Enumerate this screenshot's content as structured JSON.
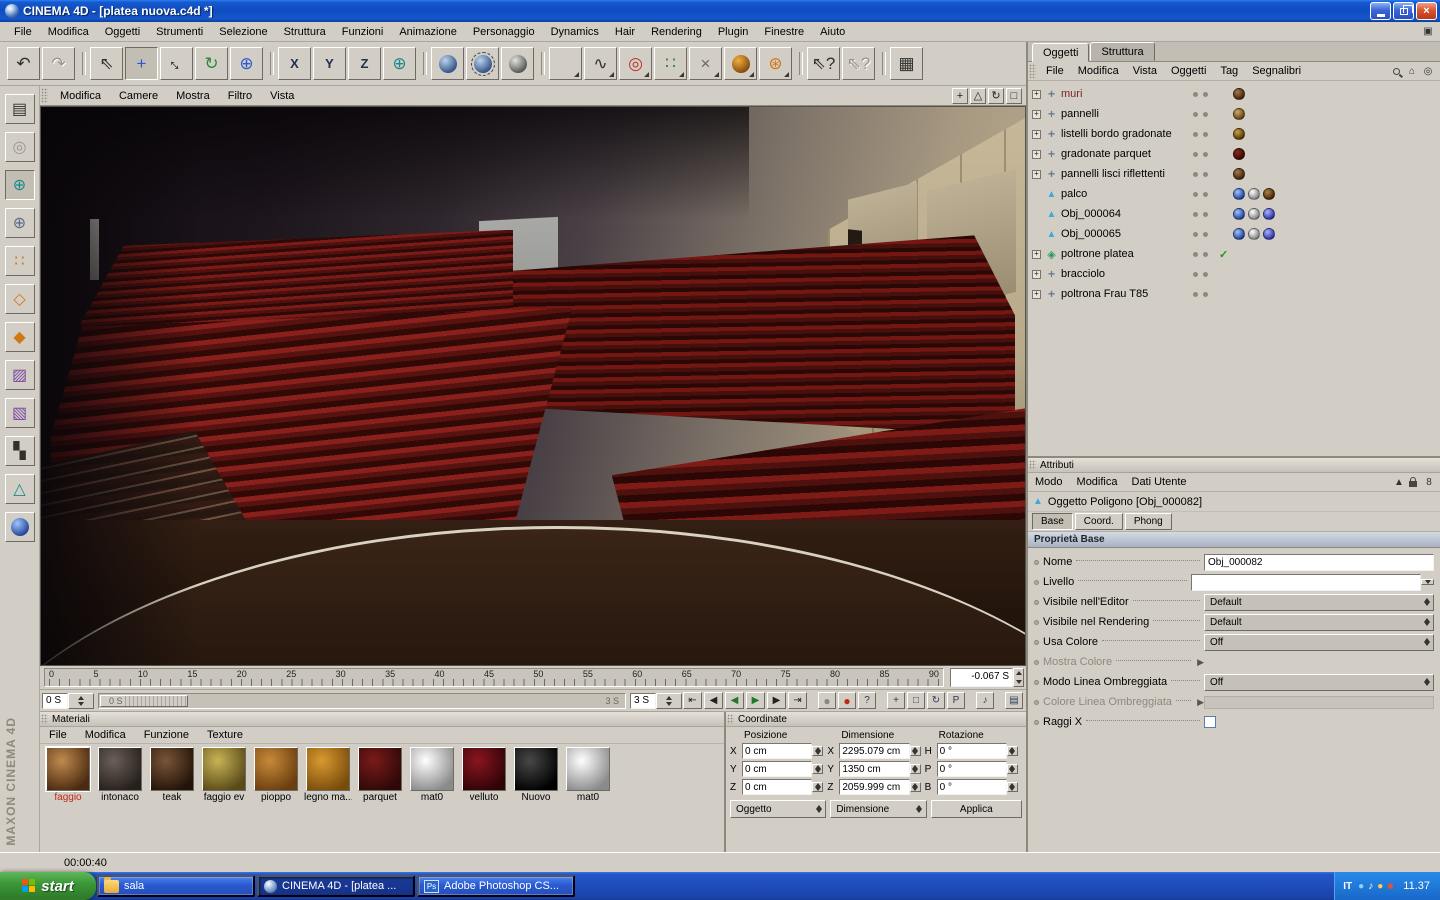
{
  "window": {
    "title": "CINEMA 4D - [platea nuova.c4d *]"
  },
  "menubar": {
    "items": [
      "File",
      "Modifica",
      "Oggetti",
      "Strumenti",
      "Selezione",
      "Struttura",
      "Funzioni",
      "Animazione",
      "Personaggio",
      "Dynamics",
      "Hair",
      "Rendering",
      "Plugin",
      "Finestre",
      "Aiuto"
    ]
  },
  "toolbar": {
    "buttons": [
      {
        "id": "undo-button",
        "glyph": "↶",
        "cls": "c-dark"
      },
      {
        "id": "redo-button",
        "glyph": "↷",
        "cls": "disabled"
      },
      {
        "id": "selection-tool",
        "glyph": "⇖",
        "cls": "c-dark",
        "gap": "gap"
      },
      {
        "id": "move-tool",
        "glyph": "+",
        "cls": "c-blue active"
      },
      {
        "id": "scale-tool",
        "glyph": "↔",
        "cls": "c-dark rot45"
      },
      {
        "id": "rotate-tool",
        "glyph": "↻",
        "cls": "c-green"
      },
      {
        "id": "current-tool",
        "glyph": "⊕",
        "cls": "c-blue"
      },
      {
        "id": "lock-x-button",
        "glyph": "X",
        "cls": "axis",
        "gap": "gap"
      },
      {
        "id": "lock-y-button",
        "glyph": "Y",
        "cls": "axis"
      },
      {
        "id": "lock-z-button",
        "glyph": "Z",
        "cls": "axis"
      },
      {
        "id": "coordinate-system-button",
        "glyph": "⊕",
        "cls": "c-teal"
      },
      {
        "id": "render-view-button",
        "ball": "#bcd3ee/#27497c",
        "gap": "gap"
      },
      {
        "id": "render-active-button",
        "ball": "#bcd3ee/#27497c",
        "cls": "framed"
      },
      {
        "id": "render-settings-button",
        "ball": "#e2e2e0/#4a4a46"
      },
      {
        "id": "add-primitive-button",
        "cube": "cube",
        "cls": "pal",
        "gap": "gap"
      },
      {
        "id": "add-spline-button",
        "glyph": "∿",
        "cls": "c-dark pal"
      },
      {
        "id": "add-nurbs-button",
        "glyph": "◎",
        "cls": "c-red pal"
      },
      {
        "id": "add-array-button",
        "glyph": "∷",
        "cls": "c-green pal"
      },
      {
        "id": "add-boole-button",
        "glyph": "×",
        "cls": "c-gray pal"
      },
      {
        "id": "add-sky-button",
        "ball": "#f0b040/#7a4208",
        "cls": "pal"
      },
      {
        "id": "add-character-button",
        "glyph": "⊛",
        "cls": "c-orange pal"
      },
      {
        "id": "help-pointer-button",
        "glyph": "⇖?",
        "cls": "c-dark",
        "gap": "gap"
      },
      {
        "id": "selection-filter-button",
        "glyph": "⇖?",
        "cls": "disabled"
      },
      {
        "id": "layout-button",
        "glyph": "▦",
        "cls": "c-dark",
        "gap": "gap"
      }
    ]
  },
  "left_toolbar": {
    "buttons": [
      {
        "id": "make-editable-button",
        "glyph": "▤",
        "cls": "c-dark"
      },
      {
        "id": "model-mode-button",
        "glyph": "◎",
        "cls": "disabled"
      },
      {
        "id": "axis-mode-button",
        "glyph": "⊕",
        "cls": "c-teal active"
      },
      {
        "id": "object-mode-button",
        "glyph": "⊕",
        "cls": "c-slate"
      },
      {
        "id": "point-mode-button",
        "glyph": "∷",
        "cls": "c-orange"
      },
      {
        "id": "edge-mode-button",
        "glyph": "◇",
        "cls": "c-orange"
      },
      {
        "id": "polygon-mode-button",
        "glyph": "◆",
        "cls": "c-orange"
      },
      {
        "id": "texture-mode-button",
        "glyph": "▨",
        "cls": "c-purple"
      },
      {
        "id": "texture-axis-mode-button",
        "glyph": "▧",
        "cls": "c-purple"
      },
      {
        "id": "uv-mode-button",
        "glyph": "▚",
        "cls": "c-dark"
      },
      {
        "id": "workplane-button",
        "glyph": "△",
        "cls": "c-teal"
      },
      {
        "id": "coordinates-button",
        "ball": "#9fc4ff/#1a3a8c"
      }
    ]
  },
  "viewport": {
    "menu": [
      "Modifica",
      "Camere",
      "Mostra",
      "Filtro",
      "Vista"
    ],
    "icons": [
      {
        "id": "viewport-pan-icon",
        "glyph": "+"
      },
      {
        "id": "viewport-zoom-icon",
        "glyph": "△"
      },
      {
        "id": "viewport-rotate-icon",
        "glyph": "↻"
      },
      {
        "id": "viewport-maximize-icon",
        "glyph": "□"
      }
    ]
  },
  "timeline": {
    "ticks": [
      "0",
      "5",
      "10",
      "15",
      "20",
      "25",
      "30",
      "35",
      "40",
      "45",
      "50",
      "55",
      "60",
      "65",
      "70",
      "75",
      "80",
      "85",
      "90"
    ],
    "frame_value": "-0.067 S"
  },
  "anim": {
    "start_value": "0 S",
    "handle_label": "0 S",
    "range_end_label": "3 S",
    "end_value": "3 S",
    "transport": [
      {
        "id": "goto-start-button",
        "glyph": "⇤"
      },
      {
        "id": "prev-key-button",
        "glyph": "◀"
      },
      {
        "id": "play-reverse-button",
        "glyph": "◀",
        "cls": "green"
      },
      {
        "id": "play-button",
        "glyph": "▶",
        "cls": "green"
      },
      {
        "id": "next-key-button",
        "glyph": "▶"
      },
      {
        "id": "goto-end-button",
        "glyph": "⇥"
      }
    ],
    "record": [
      {
        "id": "record-keyframe-button",
        "glyph": "●",
        "cls": "gray-ball gap"
      },
      {
        "id": "record-button",
        "glyph": "●",
        "cls": "red-ball"
      },
      {
        "id": "help-button",
        "glyph": "?"
      },
      {
        "id": "key-position-button",
        "glyph": "+",
        "cls": "gap"
      },
      {
        "id": "key-scale-button",
        "glyph": "□"
      },
      {
        "id": "key-rotation-button",
        "glyph": "↻"
      },
      {
        "id": "key-parameter-button",
        "glyph": "P"
      },
      {
        "id": "sound-button",
        "glyph": "♪",
        "cls": "gap"
      },
      {
        "id": "mini-panel-button",
        "glyph": "▤",
        "cls": "gap"
      }
    ]
  },
  "materials": {
    "title": "Materiali",
    "menu": [
      "File",
      "Modifica",
      "Funzione",
      "Texture"
    ],
    "items": [
      {
        "name": "faggio",
        "hi": "#c08a4f",
        "lo": "#4a2a10",
        "cls": "selected"
      },
      {
        "name": "intonaco",
        "hi": "#6b5f58",
        "lo": "#26201c"
      },
      {
        "name": "teak",
        "hi": "#7a5538",
        "lo": "#221408"
      },
      {
        "name": "faggio ev",
        "hi": "#c8b456",
        "lo": "#5a4a18"
      },
      {
        "name": "pioppo",
        "hi": "#c88a3a",
        "lo": "#6a3e0e"
      },
      {
        "name": "legno ma...",
        "hi": "#d89a30",
        "lo": "#7a4c0c"
      },
      {
        "name": "parquet",
        "hi": "#7a1a1a",
        "lo": "#2e0808"
      },
      {
        "name": "mat0",
        "hi": "#ffffff",
        "lo": "#8a8a8a"
      },
      {
        "name": "velluto",
        "hi": "#8a1520",
        "lo": "#2e0406"
      },
      {
        "name": "Nuovo",
        "hi": "#484848",
        "lo": "#000000"
      },
      {
        "name": "mat0",
        "hi": "#ffffff",
        "lo": "#8a8a8a"
      }
    ]
  },
  "coordinates": {
    "title": "Coordinate",
    "col_position": "Posizione",
    "col_dimension": "Dimensione",
    "col_rotation": "Rotazione",
    "pos": {
      "xl": "X",
      "x": "0 cm",
      "yl": "Y",
      "y": "0 cm",
      "zl": "Z",
      "z": "0 cm"
    },
    "dim": {
      "xl": "X",
      "x": "2295.079 cm",
      "yl": "Y",
      "y": "1350 cm",
      "zl": "Z",
      "z": "2059.999 cm"
    },
    "rot": {
      "hl": "H",
      "h": "0 °",
      "pl": "P",
      "p": "0 °",
      "bl": "B",
      "b": "0 °"
    },
    "mode_object": "Oggetto",
    "mode_dimension": "Dimensione",
    "apply": "Applica"
  },
  "object_manager": {
    "tabs": {
      "objects": "Oggetti",
      "structure": "Struttura"
    },
    "menu": [
      "File",
      "Modifica",
      "Vista",
      "Oggetti",
      "Tag",
      "Segnalibri"
    ],
    "items": [
      {
        "label": "muri",
        "type": "group",
        "expand": "+",
        "color": "#7a1f1f",
        "tags": [
          {
            "hi": "#a87848",
            "lo": "#3a2008"
          }
        ]
      },
      {
        "label": "pannelli",
        "type": "group",
        "expand": "+",
        "tags": [
          {
            "hi": "#cfa964",
            "lo": "#5a3c14"
          }
        ]
      },
      {
        "label": "listelli bordo gradonate",
        "type": "group",
        "expand": "+",
        "tags": [
          {
            "hi": "#c9a23e",
            "lo": "#4a300a"
          }
        ]
      },
      {
        "label": "gradonate parquet",
        "type": "group",
        "expand": "+",
        "tags": [
          {
            "hi": "#8a2818",
            "lo": "#2e0a04"
          }
        ]
      },
      {
        "label": "pannelli lisci riflettenti",
        "type": "group",
        "expand": "+",
        "tags": [
          {
            "hi": "#a87848",
            "lo": "#38200a"
          }
        ]
      },
      {
        "label": "palco",
        "type": "poly",
        "tags": [
          {
            "hi": "#9ec2ff",
            "lo": "#1c3a8c"
          },
          {
            "hi": "#ffffff",
            "lo": "#7a7a7a"
          },
          {
            "hi": "#b08048",
            "lo": "#3a2208"
          }
        ]
      },
      {
        "label": "Obj_000064",
        "type": "poly",
        "tags": [
          {
            "hi": "#9ec2ff",
            "lo": "#1c3a8c"
          },
          {
            "hi": "#ffffff",
            "lo": "#7a7a7a"
          },
          {
            "hi": "#aab2ff",
            "lo": "#232c96"
          }
        ]
      },
      {
        "label": "Obj_000065",
        "type": "poly",
        "tags": [
          {
            "hi": "#9ec2ff",
            "lo": "#1c3a8c"
          },
          {
            "hi": "#ffffff",
            "lo": "#7a7a7a"
          },
          {
            "hi": "#aab2ff",
            "lo": "#232c96"
          }
        ]
      },
      {
        "label": "poltrone platea",
        "type": "inst",
        "expand": "+",
        "check": "✓"
      },
      {
        "label": "bracciolo",
        "type": "group",
        "expand": "+"
      },
      {
        "label": "poltrona Frau T85",
        "type": "group",
        "expand": "+"
      }
    ]
  },
  "attributes": {
    "title": "Attributi",
    "menu": [
      "Modo",
      "Modifica",
      "Dati Utente"
    ],
    "object_label": "Oggetto Poligono [Obj_000082]",
    "tabs": {
      "base": "Base",
      "coord": "Coord.",
      "phong": "Phong"
    },
    "section": "Proprietà Base",
    "fields": {
      "nome": {
        "label": "Nome",
        "value": "Obj_000082"
      },
      "livello": {
        "label": "Livello"
      },
      "visibile_editor": {
        "label": "Visibile nell'Editor",
        "value": "Default"
      },
      "visibile_rendering": {
        "label": "Visibile nel Rendering",
        "value": "Default"
      },
      "usa_colore": {
        "label": "Usa Colore",
        "value": "Off"
      },
      "mostra_colore": {
        "label": "Mostra Colore"
      },
      "modo_linea": {
        "label": "Modo Linea Ombreggiata",
        "value": "Off"
      },
      "colore_linea": {
        "label": "Colore Linea Ombreggiata"
      },
      "raggi_x": {
        "label": "Raggi X"
      }
    }
  },
  "statusbar": {
    "time": "00:00:40"
  },
  "brand": "MAXON  CINEMA 4D",
  "taskbar": {
    "start": "start",
    "tasks": [
      {
        "label": "sala",
        "icon": "folder"
      },
      {
        "label": "CINEMA 4D - [platea ...",
        "icon": "c4d",
        "state": "active"
      },
      {
        "label": "Adobe Photoshop CS...",
        "icon": "ps"
      }
    ],
    "tray": {
      "lang": "IT",
      "icons": [
        {
          "id": "tray-network-icon",
          "glyph": "●",
          "color": "#8fd0ff"
        },
        {
          "id": "tray-volume-icon",
          "glyph": "♪",
          "color": "#ffffff"
        },
        {
          "id": "tray-update-icon",
          "glyph": "●",
          "color": "#ffd24a"
        },
        {
          "id": "tray-antivirus-icon",
          "glyph": "■",
          "color": "#e05040"
        }
      ],
      "clock": "11.37"
    }
  }
}
